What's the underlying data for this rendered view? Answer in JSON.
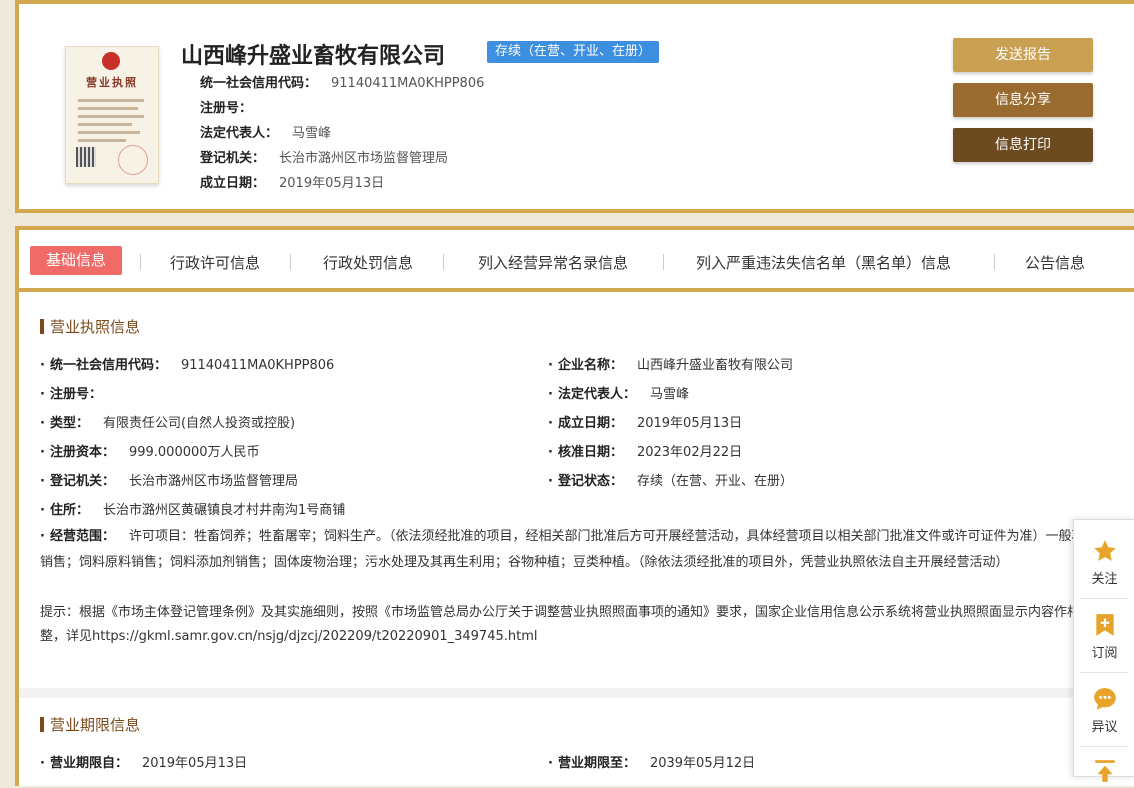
{
  "header": {
    "company_name": "山西峰升盛业畜牧有限公司",
    "status_badge": "存续（在营、开业、在册）",
    "license_title": "营业执照",
    "rows": [
      {
        "label": "统一社会信用代码：",
        "value": "91140411MA0KHPP806"
      },
      {
        "label": "注册号：",
        "value": ""
      },
      {
        "label": "法定代表人：",
        "value": "马雪峰"
      },
      {
        "label": "登记机关：",
        "value": "长治市潞州区市场监督管理局"
      },
      {
        "label": "成立日期：",
        "value": "2019年05月13日"
      }
    ],
    "buttons": [
      {
        "label": "发送报告",
        "color": "#caa052"
      },
      {
        "label": "信息分享",
        "color": "#9a6b2e"
      },
      {
        "label": "信息打印",
        "color": "#6b4b1f"
      }
    ]
  },
  "tabs": [
    {
      "label": "基础信息"
    },
    {
      "label": "行政许可信息"
    },
    {
      "label": "行政处罚信息"
    },
    {
      "label": "列入经营异常名录信息"
    },
    {
      "label": "列入严重违法失信名单（黑名单）信息"
    },
    {
      "label": "公告信息"
    }
  ],
  "license_section": {
    "title": "营业执照信息",
    "left": [
      {
        "label": "统一社会信用代码：",
        "value": "91140411MA0KHPP806"
      },
      {
        "label": "注册号：",
        "value": ""
      },
      {
        "label": "类型：",
        "value": "有限责任公司(自然人投资或控股)"
      },
      {
        "label": "注册资本：",
        "value": "999.000000万人民币"
      },
      {
        "label": "登记机关：",
        "value": "长治市潞州区市场监督管理局"
      },
      {
        "label": "住所：",
        "value": "长治市潞州区黄碾镇良才村井南沟1号商铺"
      }
    ],
    "right": [
      {
        "label": "企业名称：",
        "value": "山西峰升盛业畜牧有限公司"
      },
      {
        "label": "法定代表人：",
        "value": "马雪峰"
      },
      {
        "label": "成立日期：",
        "value": "2019年05月13日"
      },
      {
        "label": "核准日期：",
        "value": "2023年02月22日"
      },
      {
        "label": "登记状态：",
        "value": "存续（在营、开业、在册）"
      }
    ],
    "scope_label": "经营范围：",
    "scope_value": "许可项目：牲畜饲养；牲畜屠宰；饲料生产。（依法须经批准的项目，经相关部门批准后方可开展经营活动，具体经营项目以相关部门批准文件或许可证件为准）一般项目：牲畜销售；饲料原料销售；饲料添加剂销售；固体废物治理；污水处理及其再生利用；谷物种植；豆类种植。（除依法须经批准的项目外，凭营业执照依法自主开展经营活动）",
    "tip": "提示：根据《市场主体登记管理条例》及其实施细则，按照《市场监管总局办公厅关于调整营业执照照面事项的通知》要求，国家企业信用信息公示系统将营业执照照面显示内容作相应调整，详见https://gkml.samr.gov.cn/nsjg/djzcj/202209/t20220901_349745.html"
  },
  "term_section": {
    "title": "营业期限信息",
    "from_label": "营业期限自：",
    "from_value": "2019年05月13日",
    "to_label": "营业期限至：",
    "to_value": "2039年05月12日"
  },
  "side_toolbar": [
    {
      "label": "关注",
      "icon": "star-icon",
      "color": "#e8a32a"
    },
    {
      "label": "订阅",
      "icon": "bookmark-plus-icon",
      "color": "#e8a32a"
    },
    {
      "label": "异议",
      "icon": "chat-bubble-icon",
      "color": "#e8a32a"
    },
    {
      "label": "",
      "icon": "up-arrow-icon",
      "color": "#e8a32a"
    }
  ]
}
